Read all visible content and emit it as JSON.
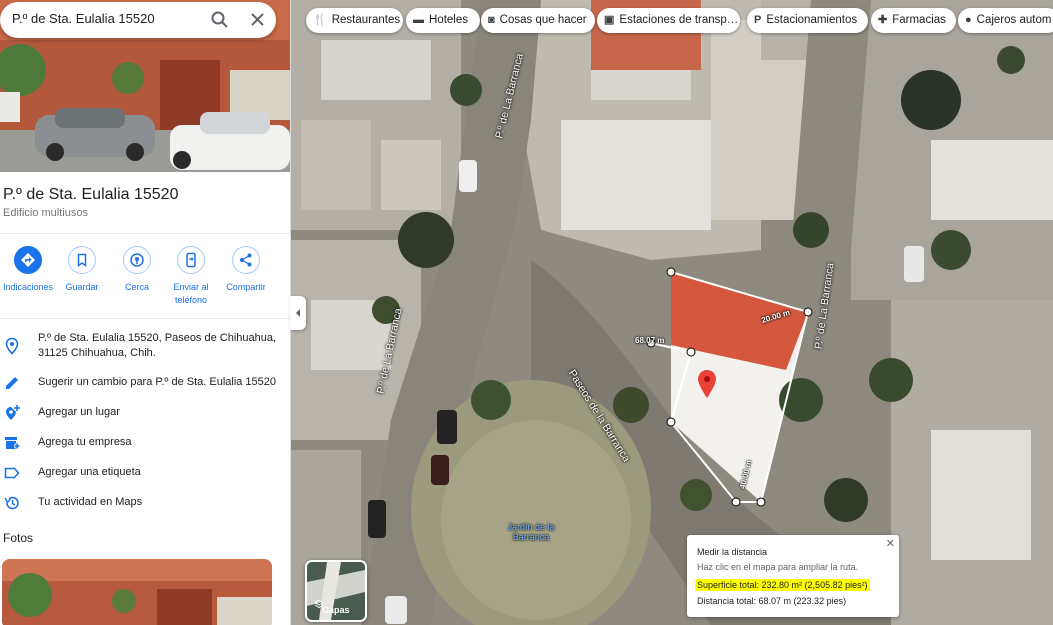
{
  "search": {
    "value": "P.º de Sta. Eulalia 15520"
  },
  "place": {
    "title": "P.º de Sta. Eulalia 15520",
    "type": "Edificio multiusos"
  },
  "actions": [
    {
      "label": "Indicaciones"
    },
    {
      "label": "Guardar"
    },
    {
      "label": "Cerca"
    },
    {
      "label": "Enviar al teléfono"
    },
    {
      "label": "Compartir"
    }
  ],
  "info": {
    "address": "P.º de Sta. Eulalia 15520, Paseos de Chihuahua, 31125 Chihuahua, Chih.",
    "suggest": "Sugerir un cambio para P.º de Sta. Eulalia 15520",
    "add_place": "Agregar un lugar",
    "add_business": "Agrega tu empresa",
    "add_label": "Agregar una etiqueta",
    "activity": "Tu actividad en Maps"
  },
  "photos_heading": "Fotos",
  "chips": [
    {
      "label": "Restaurantes",
      "icon": "restaurant-icon"
    },
    {
      "label": "Hoteles",
      "icon": "hotel-icon"
    },
    {
      "label": "Cosas que hacer",
      "icon": "camera-icon"
    },
    {
      "label": "Estaciones de transp…",
      "icon": "transit-icon"
    },
    {
      "label": "Estacionamientos",
      "icon": "parking-icon"
    },
    {
      "label": "Farmacias",
      "icon": "pharmacy-icon"
    },
    {
      "label": "Cajeros autom",
      "icon": "atm-icon"
    }
  ],
  "map": {
    "streets": [
      "P.º de La Barranca",
      "P.º de La Barranca",
      "P.º de La Barranca",
      "Paseos de la Barranca"
    ],
    "park": "Jardín de la Barranca",
    "measure_labels": [
      "20.00 m",
      "68.07 m",
      "40.00 m"
    ]
  },
  "layers": {
    "label": "Capas"
  },
  "measure": {
    "title": "Medir la distancia",
    "hint": "Haz clic en el mapa para ampliar la ruta.",
    "surface": "Superficie total: 232.80 m² (2,505.82 pies²)",
    "distance": "Distancia total: 68.07 m (223.32 pies)"
  },
  "colors": {
    "accent": "#1a73e8",
    "highlight": "#ffff00",
    "pin": "#ea4335"
  }
}
